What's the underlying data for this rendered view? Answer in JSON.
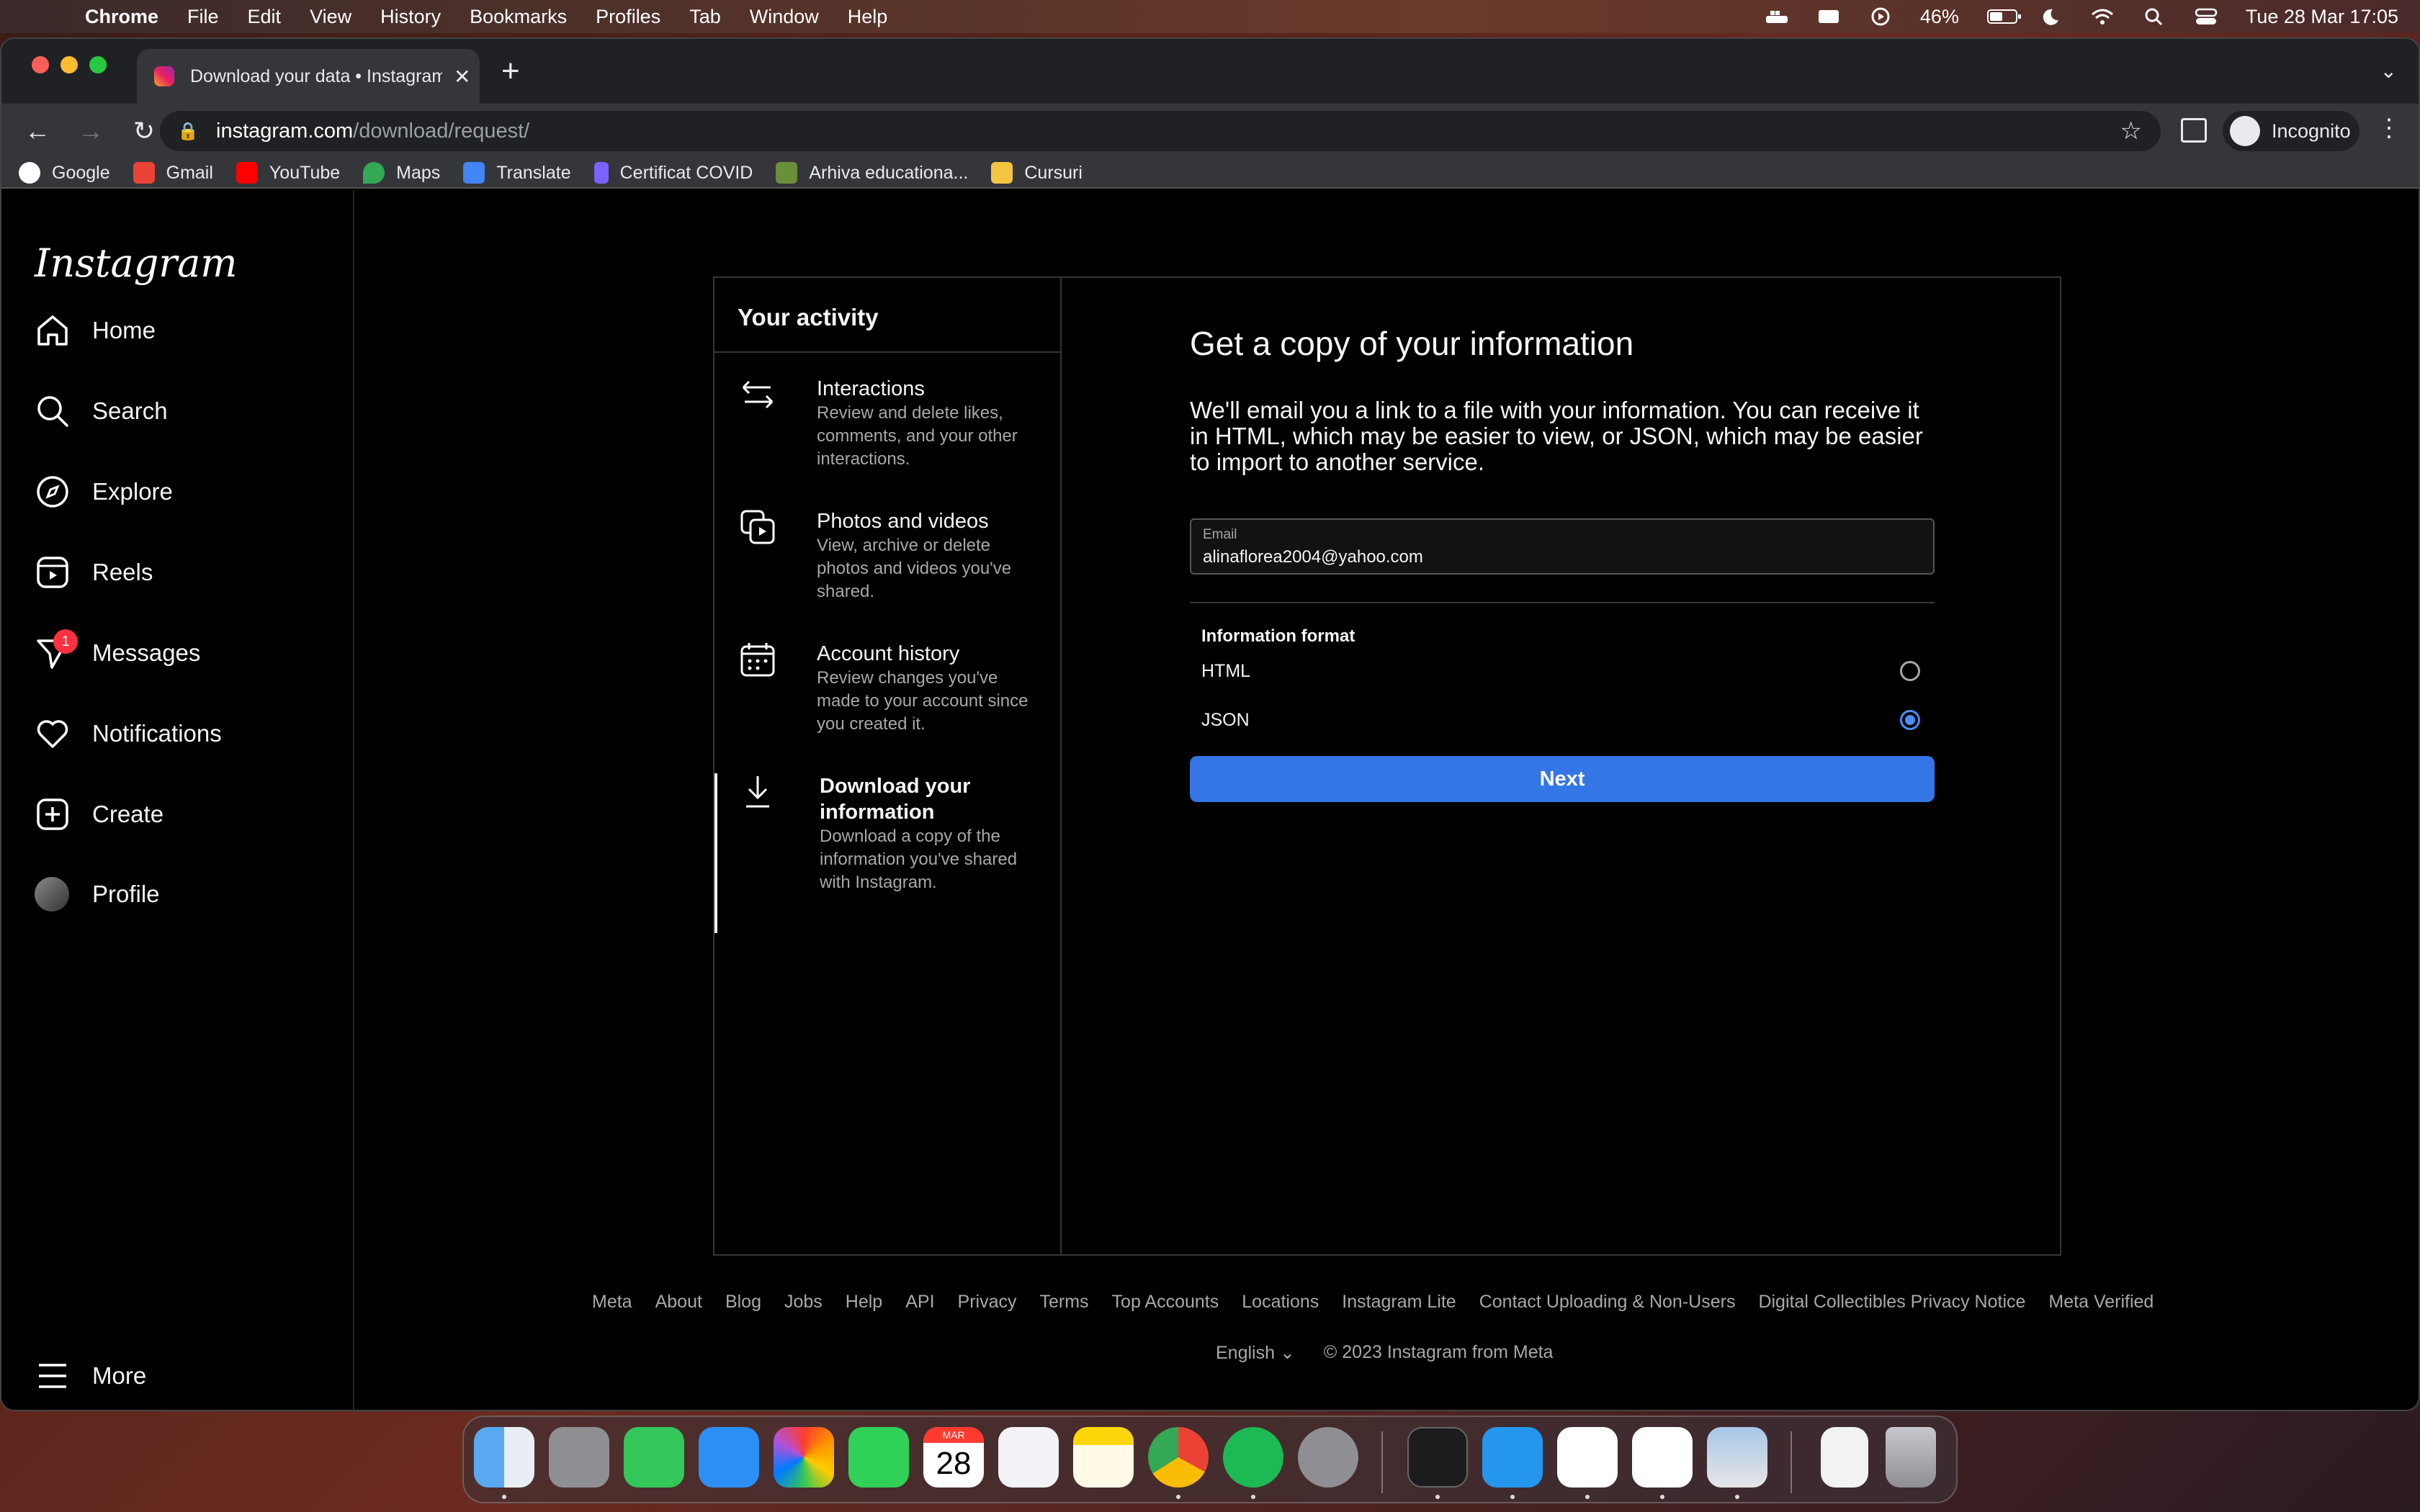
{
  "menubar": {
    "app": "Chrome",
    "items": [
      "File",
      "Edit",
      "View",
      "History",
      "Bookmarks",
      "Profiles",
      "Tab",
      "Window",
      "Help"
    ],
    "battery": "46%",
    "clock": "Tue 28 Mar  17:05"
  },
  "browser": {
    "tab_title": "Download your data • Instagram",
    "url_host": "instagram.com",
    "url_path": "/download/request/",
    "profile_label": "Incognito",
    "bookmarks": [
      "Google",
      "Gmail",
      "YouTube",
      "Maps",
      "Translate",
      "Certificat COVID",
      "Arhiva educationa...",
      "Cursuri"
    ]
  },
  "sidebar": {
    "logo": "Instagram",
    "items": [
      "Home",
      "Search",
      "Explore",
      "Reels",
      "Messages",
      "Notifications",
      "Create",
      "Profile"
    ],
    "messages_badge": "1",
    "more": "More"
  },
  "activity": {
    "heading": "Your activity",
    "items": [
      {
        "title": "Interactions",
        "desc": "Review and delete likes, comments, and your other interactions."
      },
      {
        "title": "Photos and videos",
        "desc": "View, archive or delete photos and videos you've shared."
      },
      {
        "title": "Account history",
        "desc": "Review changes you've made to your account since you created it."
      },
      {
        "title": "Download your information",
        "desc": "Download a copy of the information you've shared with Instagram."
      }
    ]
  },
  "main": {
    "title": "Get a copy of your information",
    "description": "We'll email you a link to a file with your information. You can receive it in HTML, which may be easier to view, or JSON, which may be easier to import to another service.",
    "email_label": "Email",
    "email_value": "alinaflorea2004@yahoo.com",
    "format_heading": "Information format",
    "options": [
      "HTML",
      "JSON"
    ],
    "selected": "JSON",
    "next_label": "Next"
  },
  "footer": {
    "links": [
      "Meta",
      "About",
      "Blog",
      "Jobs",
      "Help",
      "API",
      "Privacy",
      "Terms",
      "Top Accounts",
      "Locations",
      "Instagram Lite",
      "Contact Uploading & Non-Users",
      "Digital Collectibles Privacy Notice",
      "Meta Verified"
    ],
    "language": "English",
    "copyright": "© 2023 Instagram from Meta"
  },
  "dock": {
    "calendar_month": "MAR",
    "calendar_day": "28"
  }
}
